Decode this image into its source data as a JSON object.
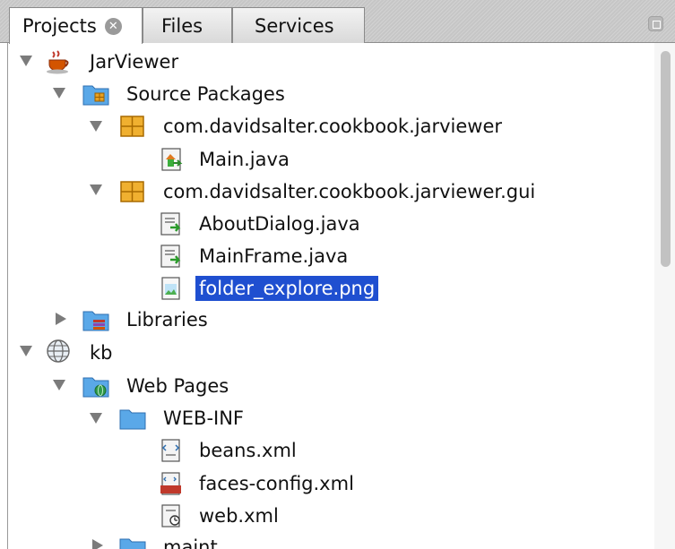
{
  "tabs": [
    {
      "label": "Projects",
      "active": true
    },
    {
      "label": "Files",
      "active": false
    },
    {
      "label": "Services",
      "active": false
    }
  ],
  "tab_close_glyph": "✕",
  "tree": [
    {
      "label": "JarViewer",
      "icon": "coffee-cup-icon",
      "arrow": "down"
    },
    {
      "label": "Source Packages",
      "icon": "source-folder-icon",
      "arrow": "down"
    },
    {
      "label": "com.davidsalter.cookbook.jarviewer",
      "icon": "package-icon",
      "arrow": "down"
    },
    {
      "label": "Main.java",
      "icon": "main-class-icon",
      "arrow": null
    },
    {
      "label": "com.davidsalter.cookbook.jarviewer.gui",
      "icon": "package-icon",
      "arrow": "down"
    },
    {
      "label": "AboutDialog.java",
      "icon": "form-class-icon",
      "arrow": null
    },
    {
      "label": "MainFrame.java",
      "icon": "form-class-icon",
      "arrow": null
    },
    {
      "label": "folder_explore.png",
      "icon": "image-file-icon",
      "arrow": null,
      "selected": true
    },
    {
      "label": "Libraries",
      "icon": "libraries-folder-icon",
      "arrow": "right"
    },
    {
      "label": "kb",
      "icon": "globe-icon",
      "arrow": "down"
    },
    {
      "label": "Web Pages",
      "icon": "web-pages-folder-icon",
      "arrow": "down"
    },
    {
      "label": "WEB-INF",
      "icon": "folder-icon",
      "arrow": "down"
    },
    {
      "label": "beans.xml",
      "icon": "xml-file-icon",
      "arrow": null
    },
    {
      "label": "faces-config.xml",
      "icon": "jsf-file-icon",
      "arrow": null
    },
    {
      "label": "web.xml",
      "icon": "web-xml-icon",
      "arrow": null
    },
    {
      "label": "maint",
      "icon": "folder-icon",
      "arrow": "right"
    }
  ],
  "colors": {
    "selection": "#1f4fd0",
    "folder": "#5aa8e8",
    "package": "#e8a020"
  }
}
